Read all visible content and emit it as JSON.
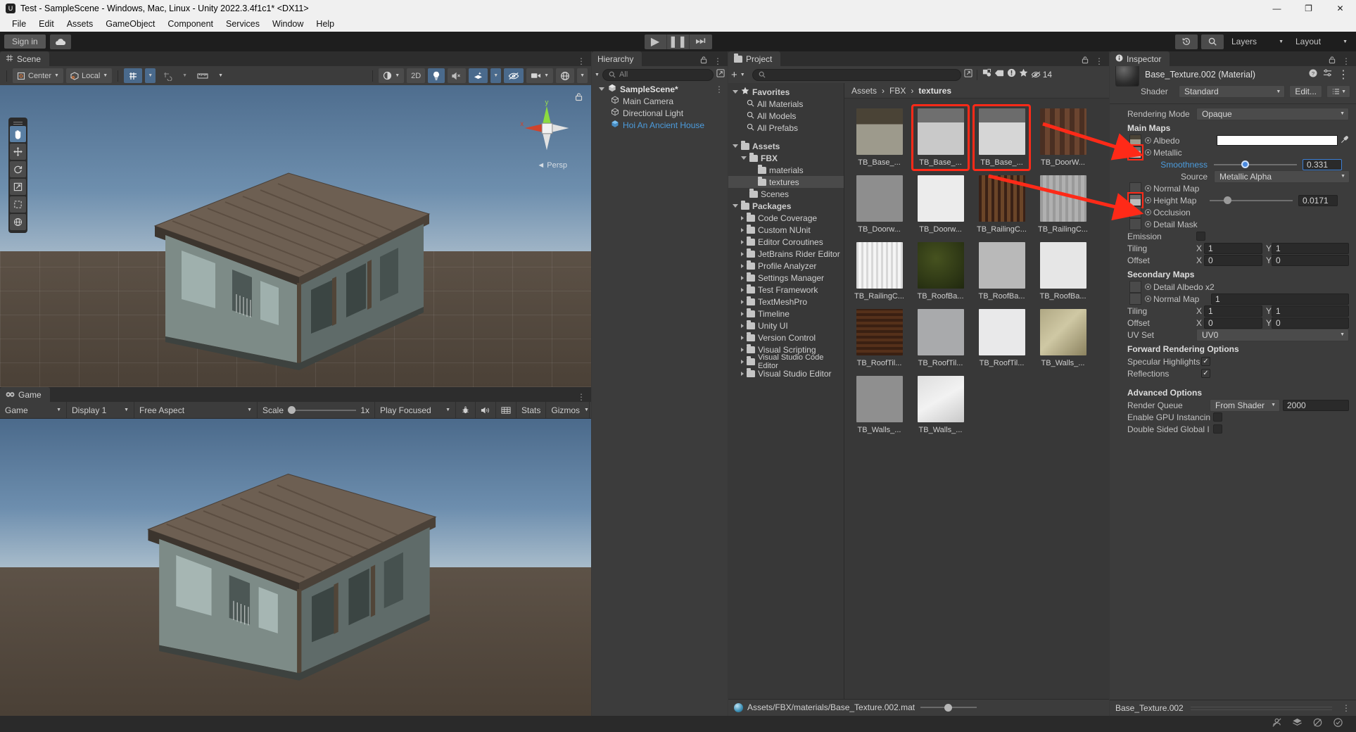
{
  "window": {
    "title": "Test - SampleScene - Windows, Mac, Linux - Unity 2022.3.4f1c1* <DX11>",
    "minimize": "—",
    "maximize": "❐",
    "close": "✕"
  },
  "menu": [
    "File",
    "Edit",
    "Assets",
    "GameObject",
    "Component",
    "Services",
    "Window",
    "Help"
  ],
  "toolbar": {
    "signin": "Sign in",
    "cloud_icon": "cloud-icon",
    "play": "▶",
    "pause": "❚❚",
    "step": "⏭",
    "history_icon": "history-icon",
    "search_icon": "search-icon",
    "layers": "Layers",
    "layout": "Layout"
  },
  "scene": {
    "tab": "Scene",
    "pivot": "Center",
    "space": "Local",
    "grid_btn": "grid-snap-icon",
    "snap_btn": "snap-increment-icon",
    "ruler_btn": "ruler-icon",
    "draw_mode": "shaded-icon",
    "two_d": "2D",
    "light_btn": "lighting-icon",
    "audio_btn": "audio-mute-icon",
    "fx_btn": "effects-icon",
    "hidden_btn": "hidden-objects-icon",
    "camera_btn": "scene-camera-icon",
    "gizmos_btn": "gizmos-icon",
    "persp_label": "Persp",
    "axis_x": "x",
    "axis_y": "y",
    "tools": [
      "hand-tool",
      "move-tool",
      "rotate-tool",
      "scale-tool",
      "rect-tool",
      "transform-tool"
    ]
  },
  "game": {
    "tab": "Game",
    "target": "Game",
    "display": "Display 1",
    "aspect": "Free Aspect",
    "scale_label": "Scale",
    "scale_value": "1x",
    "play_mode": "Play Focused",
    "mute_icon": "audio-icon",
    "bug_icon": "gizmos-bug-icon",
    "grid_icon": "frame-debugger-icon",
    "stats": "Stats",
    "gizmos": "Gizmos"
  },
  "hierarchy": {
    "tab": "Hierarchy",
    "search_placeholder": "All",
    "items": [
      {
        "label": "SampleScene*",
        "depth": 0,
        "expanded": true,
        "bold": true,
        "icon": "scene-icon"
      },
      {
        "label": "Main Camera",
        "depth": 1,
        "icon": "gameobject-icon"
      },
      {
        "label": "Directional Light",
        "depth": 1,
        "icon": "gameobject-icon"
      },
      {
        "label": "Hoi An Ancient House",
        "depth": 1,
        "icon": "prefab-icon",
        "selected": true
      }
    ]
  },
  "project": {
    "tab": "Project",
    "add_label": "+",
    "search_placeholder": "",
    "item_count": "14",
    "breadcrumb": [
      "Assets",
      "FBX",
      "textures"
    ],
    "tree": [
      {
        "label": "Favorites",
        "depth": 0,
        "type": "star",
        "expanded": true,
        "bold": true
      },
      {
        "label": "All Materials",
        "depth": 1,
        "type": "search"
      },
      {
        "label": "All Models",
        "depth": 1,
        "type": "search"
      },
      {
        "label": "All Prefabs",
        "depth": 1,
        "type": "search"
      },
      {
        "label": "Assets",
        "depth": 0,
        "type": "folder-open",
        "expanded": true,
        "bold": true
      },
      {
        "label": "FBX",
        "depth": 1,
        "type": "folder-open",
        "expanded": true,
        "bold": true
      },
      {
        "label": "materials",
        "depth": 2,
        "type": "folder"
      },
      {
        "label": "textures",
        "depth": 2,
        "type": "folder",
        "selected": true
      },
      {
        "label": "Scenes",
        "depth": 1,
        "type": "folder"
      },
      {
        "label": "Packages",
        "depth": 0,
        "type": "folder-open",
        "expanded": true,
        "bold": true
      },
      {
        "label": "Code Coverage",
        "depth": 1,
        "type": "folder",
        "collapsed": true
      },
      {
        "label": "Custom NUnit",
        "depth": 1,
        "type": "folder",
        "collapsed": true
      },
      {
        "label": "Editor Coroutines",
        "depth": 1,
        "type": "folder",
        "collapsed": true
      },
      {
        "label": "JetBrains Rider Editor",
        "depth": 1,
        "type": "folder",
        "collapsed": true
      },
      {
        "label": "Profile Analyzer",
        "depth": 1,
        "type": "folder",
        "collapsed": true
      },
      {
        "label": "Settings Manager",
        "depth": 1,
        "type": "folder",
        "collapsed": true
      },
      {
        "label": "Test Framework",
        "depth": 1,
        "type": "folder",
        "collapsed": true
      },
      {
        "label": "TextMeshPro",
        "depth": 1,
        "type": "folder",
        "collapsed": true
      },
      {
        "label": "Timeline",
        "depth": 1,
        "type": "folder",
        "collapsed": true
      },
      {
        "label": "Unity UI",
        "depth": 1,
        "type": "folder",
        "collapsed": true
      },
      {
        "label": "Version Control",
        "depth": 1,
        "type": "folder",
        "collapsed": true
      },
      {
        "label": "Visual Scripting",
        "depth": 1,
        "type": "folder",
        "collapsed": true
      },
      {
        "label": "Visual Studio Code Editor",
        "depth": 1,
        "type": "folder",
        "collapsed": true
      },
      {
        "label": "Visual Studio Editor",
        "depth": 1,
        "type": "folder",
        "collapsed": true
      }
    ],
    "assets": [
      {
        "label": "TB_Base_...",
        "thumb": "base-albedo",
        "highlight": false
      },
      {
        "label": "TB_Base_...",
        "thumb": "base-metallic",
        "highlight": true
      },
      {
        "label": "TB_Base_...",
        "thumb": "base-height",
        "highlight": true
      },
      {
        "label": "TB_DoorW...",
        "thumb": "door-albedo",
        "highlight": false
      },
      {
        "label": "TB_Doorw...",
        "thumb": "door-grey",
        "highlight": false
      },
      {
        "label": "TB_Doorw...",
        "thumb": "door-white",
        "highlight": false
      },
      {
        "label": "TB_RailingC...",
        "thumb": "railing-wood",
        "highlight": false
      },
      {
        "label": "TB_RailingC...",
        "thumb": "railing-grey",
        "highlight": false
      },
      {
        "label": "TB_RailingC...",
        "thumb": "railing-white",
        "highlight": false
      },
      {
        "label": "TB_RoofBa...",
        "thumb": "roof-dark",
        "highlight": false
      },
      {
        "label": "TB_RoofBa...",
        "thumb": "roof-grey",
        "highlight": false
      },
      {
        "label": "TB_RoofBa...",
        "thumb": "roof-white",
        "highlight": false
      },
      {
        "label": "TB_RoofTil...",
        "thumb": "rooftile-brown",
        "highlight": false
      },
      {
        "label": "TB_RoofTil...",
        "thumb": "rooftile-grey",
        "highlight": false
      },
      {
        "label": "TB_RoofTil...",
        "thumb": "rooftile-white",
        "highlight": false
      },
      {
        "label": "TB_Walls_...",
        "thumb": "walls-tan",
        "highlight": false
      },
      {
        "label": "TB_Walls_...",
        "thumb": "walls-grey",
        "highlight": false
      },
      {
        "label": "TB_Walls_...",
        "thumb": "walls-white",
        "highlight": false
      }
    ],
    "footer_path": "Assets/FBX/materials/Base_Texture.002.mat"
  },
  "inspector": {
    "tab": "Inspector",
    "object_title": "Base_Texture.002 (Material)",
    "shader_label": "Shader",
    "shader_value": "Standard",
    "edit_button": "Edit...",
    "rendering_mode_label": "Rendering Mode",
    "rendering_mode_value": "Opaque",
    "main_maps_header": "Main Maps",
    "albedo_label": "Albedo",
    "metallic_label": "Metallic",
    "smoothness_label": "Smoothness",
    "smoothness_value": "0.331",
    "smoothness_pct": 33.1,
    "source_label": "Source",
    "source_value": "Metallic Alpha",
    "normal_map_label": "Normal Map",
    "height_map_label": "Height Map",
    "height_value": "0.0171",
    "height_pct": 17.0,
    "occlusion_label": "Occlusion",
    "detail_mask_label": "Detail Mask",
    "emission_label": "Emission",
    "tiling_label": "Tiling",
    "offset_label": "Offset",
    "x_label": "X",
    "y_label": "Y",
    "tiling_x": "1",
    "tiling_y": "1",
    "offset_x": "0",
    "offset_y": "0",
    "secondary_maps_header": "Secondary Maps",
    "detail_albedo_label": "Detail Albedo x2",
    "secondary_normal_label": "Normal Map",
    "secondary_normal_value": "1",
    "sec_tiling_x": "1",
    "sec_tiling_y": "1",
    "sec_offset_x": "0",
    "sec_offset_y": "0",
    "uv_set_label": "UV Set",
    "uv_set_value": "UV0",
    "forward_header": "Forward Rendering Options",
    "specular_label": "Specular Highlights",
    "specular_checked": true,
    "reflections_label": "Reflections",
    "reflections_checked": true,
    "advanced_header": "Advanced Options",
    "render_queue_label": "Render Queue",
    "render_queue_source": "From Shader",
    "render_queue_value": "2000",
    "gpu_instancing_label": "Enable GPU Instancin",
    "double_sided_label": "Double Sided Global I",
    "footer_name": "Base_Texture.002",
    "help_icon": "help-icon",
    "preset_icon": "preset-icon",
    "menu_icon": "kebab-menu-icon"
  },
  "statusbar": {
    "icons": [
      "no-collaboration-icon",
      "layers-stack-icon",
      "no-sync-icon",
      "check-circle-icon"
    ]
  },
  "colors": {
    "accent_red": "#ff2a18",
    "accent_blue": "#4a8ae0",
    "panel_bg": "#3c3c3c",
    "dark_bg": "#2a2a2a",
    "selection": "#4a6a8c"
  }
}
